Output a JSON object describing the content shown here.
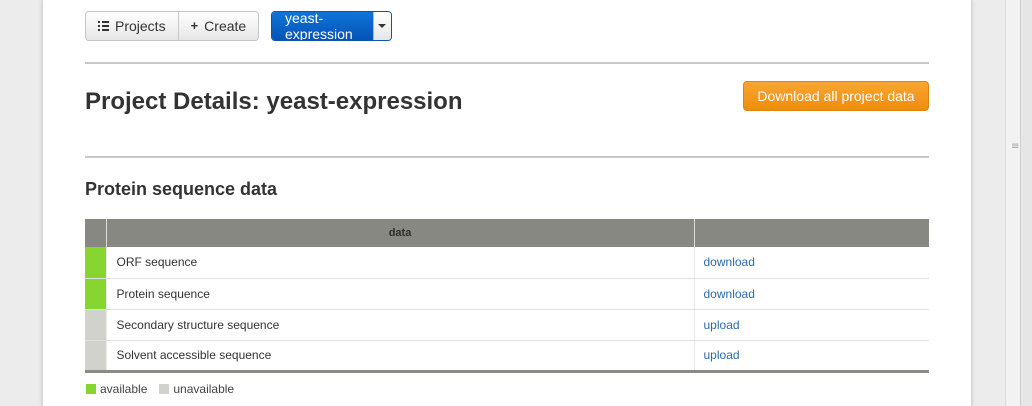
{
  "toolbar": {
    "projects_label": "Projects",
    "create_label": "Create",
    "current_project": "yeast-expression"
  },
  "header": {
    "title": "Project Details: yeast-expression",
    "download_all_label": "Download all project data"
  },
  "section": {
    "title": "Protein sequence data"
  },
  "table": {
    "columns": [
      "",
      "data",
      ""
    ],
    "rows": [
      {
        "name": "ORF sequence",
        "action": "download",
        "status": "available"
      },
      {
        "name": "Protein sequence",
        "action": "download",
        "status": "available"
      },
      {
        "name": "Secondary structure sequence",
        "action": "upload",
        "status": "unavailable"
      },
      {
        "name": "Solvent accessible sequence",
        "action": "upload",
        "status": "unavailable"
      }
    ]
  },
  "legend": {
    "available": "available",
    "unavailable": "unavailable"
  },
  "colors": {
    "available": "#86d62f",
    "unavailable": "#d2d2cd",
    "primary": "#0a64c8",
    "warning": "#f39a1e",
    "link": "#2a6ab3"
  },
  "icons": {
    "projects": "list-icon",
    "create": "plus-icon",
    "dropdown": "caret-down-icon",
    "scrollbar_grip": "grip-icon"
  }
}
